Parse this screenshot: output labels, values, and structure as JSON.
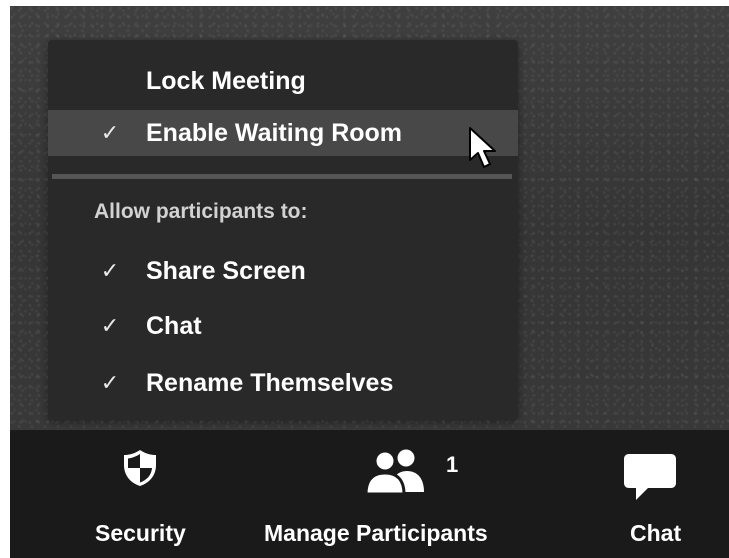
{
  "security_menu": {
    "items": [
      {
        "label": "Lock Meeting",
        "checked": false,
        "highlighted": false
      },
      {
        "label": "Enable Waiting Room",
        "checked": true,
        "highlighted": true
      }
    ],
    "section_label": "Allow participants to:",
    "permissions": [
      {
        "label": "Share Screen",
        "checked": true
      },
      {
        "label": "Chat",
        "checked": true
      },
      {
        "label": "Rename Themselves",
        "checked": true
      }
    ],
    "check_glyph": "✓"
  },
  "toolbar": {
    "security": {
      "label": "Security",
      "icon": "shield-icon"
    },
    "participants": {
      "label": "Manage Participants",
      "icon": "participants-icon",
      "count": "1"
    },
    "chat": {
      "label": "Chat",
      "icon": "chat-bubble-icon"
    }
  },
  "colors": {
    "menu_background": "#292929",
    "highlight": "#484848",
    "toolbar_background": "#1a1a1a",
    "text": "#ffffff"
  }
}
